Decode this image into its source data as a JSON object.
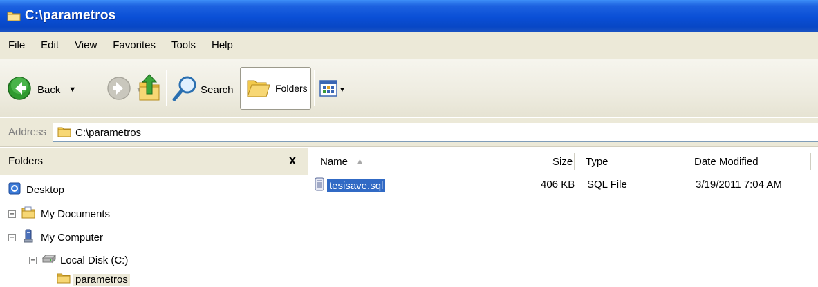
{
  "window": {
    "title": "C:\\parametros"
  },
  "menu": {
    "items": [
      "File",
      "Edit",
      "View",
      "Favorites",
      "Tools",
      "Help"
    ]
  },
  "toolbar": {
    "back_label": "Back",
    "search_label": "Search",
    "folders_label": "Folders"
  },
  "address": {
    "label": "Address",
    "value": "C:\\parametros"
  },
  "folders_pane": {
    "title": "Folders",
    "close_glyph": "x",
    "tree": [
      {
        "label": "Desktop",
        "icon": "desktop-icon",
        "expander": ""
      },
      {
        "label": "My Documents",
        "icon": "my-documents-icon",
        "expander": "+"
      },
      {
        "label": "My Computer",
        "icon": "my-computer-icon",
        "expander": "−"
      },
      {
        "label": "Local Disk (C:)",
        "icon": "local-disk-icon",
        "expander": "−"
      },
      {
        "label": "parametros",
        "icon": "folder-icon",
        "expander": ""
      }
    ]
  },
  "details": {
    "columns": [
      "Name",
      "Size",
      "Type",
      "Date Modified"
    ],
    "sort_indicator": "▲",
    "files": [
      {
        "name": "tesisave.sql",
        "size": "406 KB",
        "type": "SQL File",
        "modified": "3/19/2011 7:04 AM"
      }
    ]
  },
  "colors": {
    "title_bar": "#0a4fd6",
    "chrome": "#ece9d8",
    "selection": "#316ac5"
  }
}
